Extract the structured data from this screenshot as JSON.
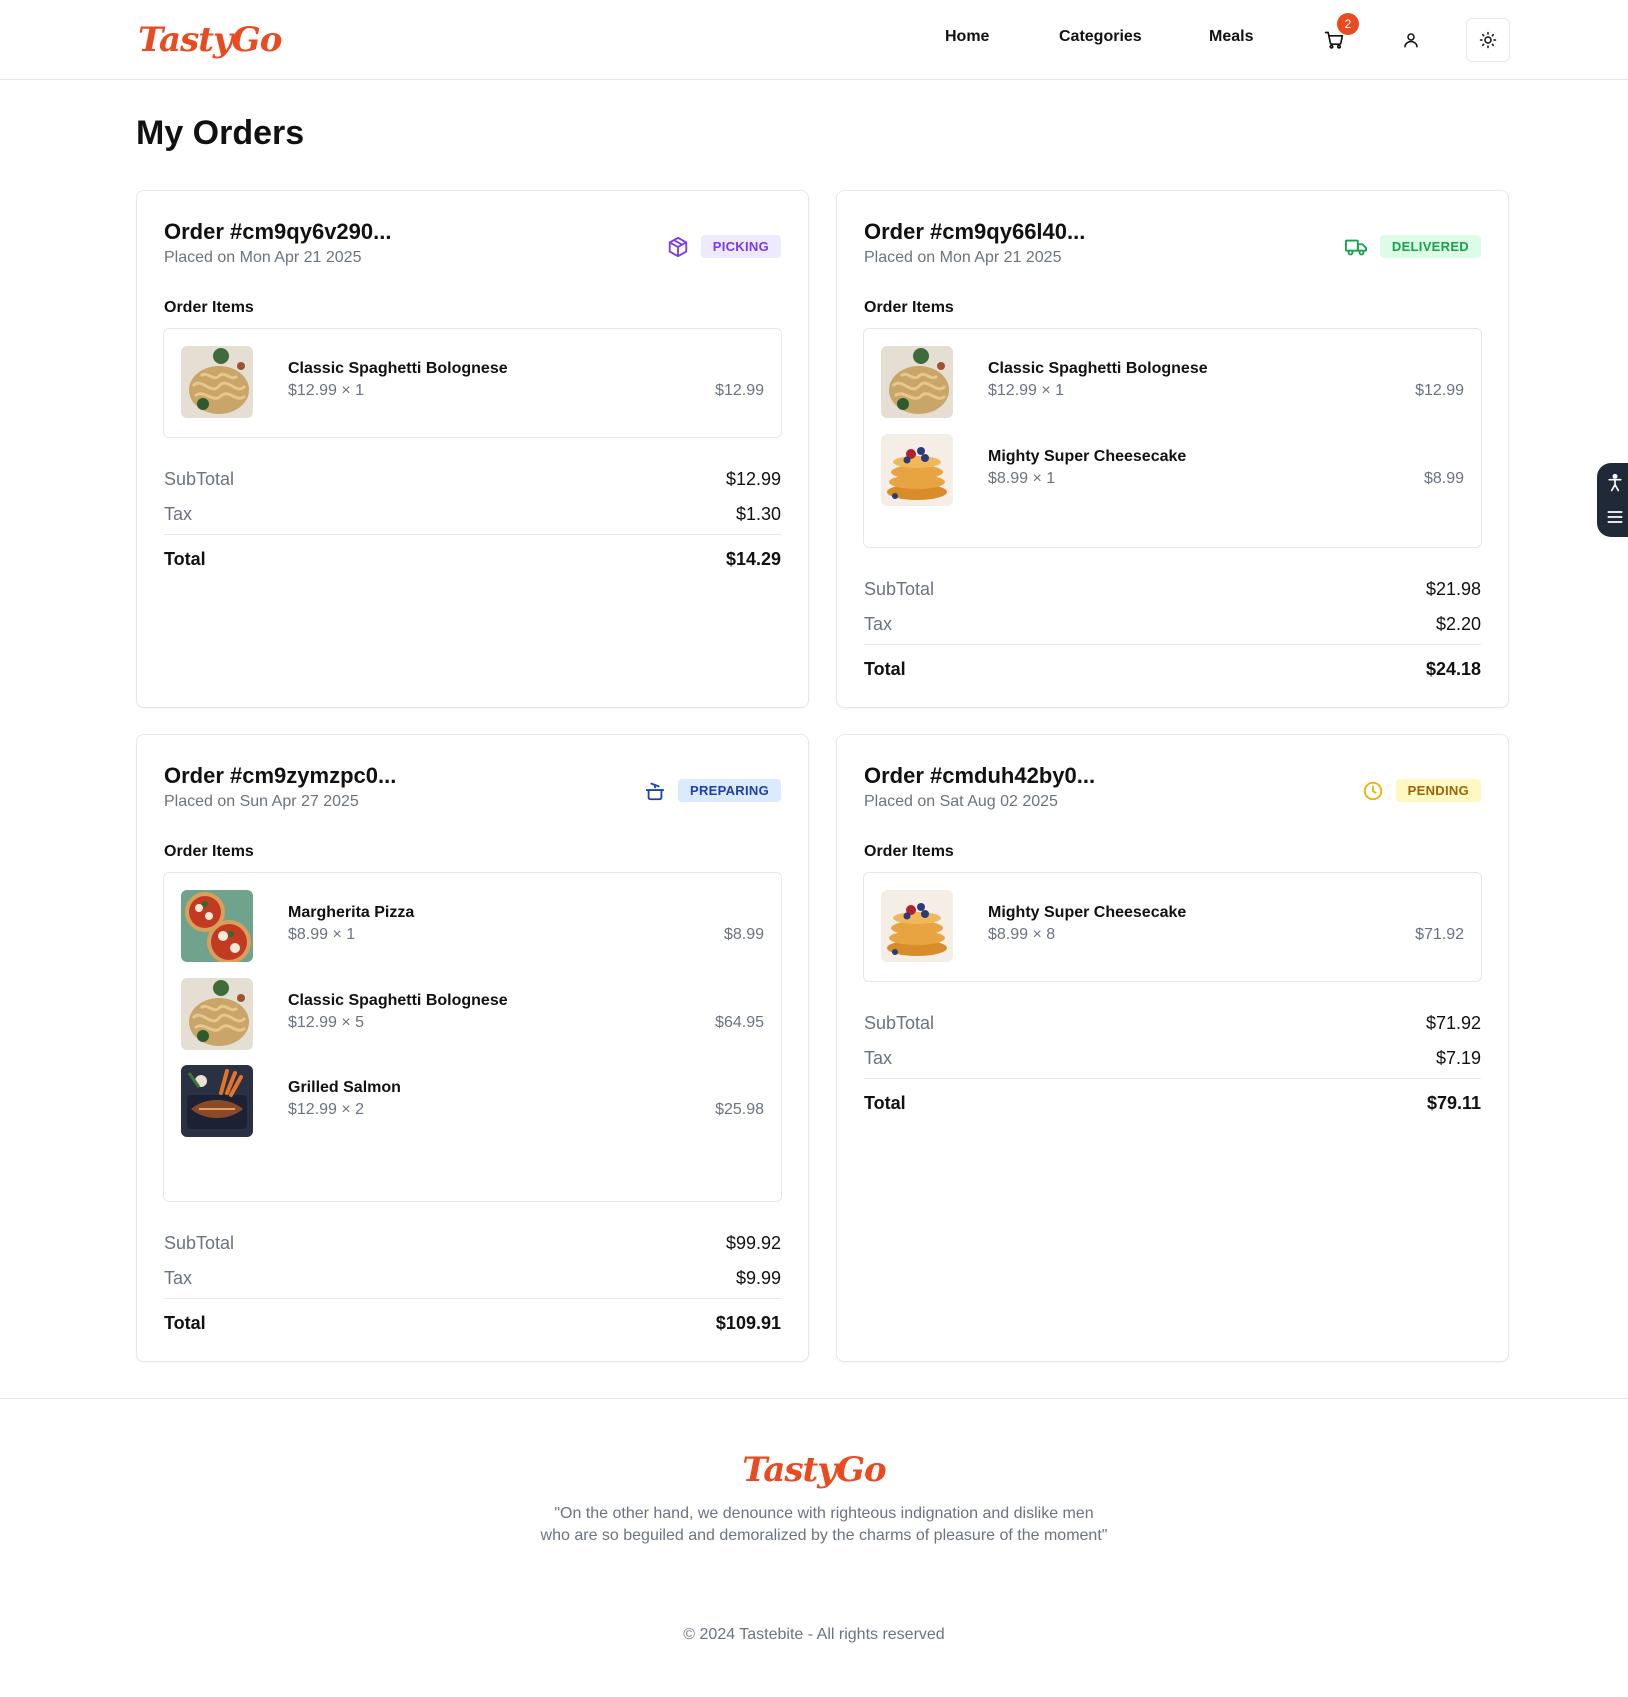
{
  "header": {
    "logo": "TastyGo",
    "nav": [
      "Home",
      "Categories",
      "Meals"
    ],
    "cart_count": "2"
  },
  "page": {
    "title": "My Orders"
  },
  "labels": {
    "order_items": "Order Items",
    "subtotal": "SubTotal",
    "tax": "Tax",
    "total": "Total"
  },
  "orders": [
    {
      "id": "Order #cm9qy6v290...",
      "date": "Placed on Mon Apr 21 2025",
      "status": "PICKING",
      "status_icon": "package-icon",
      "status_color": "#7c3aed",
      "status_bg": "#ede9fe",
      "items": [
        {
          "name": "Classic Spaghetti Bolognese",
          "qty": "$12.99 × 1",
          "total": "$12.99",
          "image": "spaghetti"
        }
      ],
      "subtotal": "$12.99",
      "tax": "$1.30",
      "total": "$14.29"
    },
    {
      "id": "Order #cm9qy66l40...",
      "date": "Placed on Mon Apr 21 2025",
      "status": "DELIVERED",
      "status_icon": "truck-icon",
      "status_color": "#16a34a",
      "status_bg": "#dcfce7",
      "items": [
        {
          "name": "Classic Spaghetti Bolognese",
          "qty": "$12.99 × 1",
          "total": "$12.99",
          "image": "spaghetti"
        },
        {
          "name": "Mighty Super Cheesecake",
          "qty": "$8.99 × 1",
          "total": "$8.99",
          "image": "pancakes"
        }
      ],
      "subtotal": "$21.98",
      "tax": "$2.20",
      "total": "$24.18"
    },
    {
      "id": "Order #cm9zymzpc0...",
      "date": "Placed on Sun Apr 27 2025",
      "status": "PREPARING",
      "status_icon": "cooking-pot-icon",
      "status_color": "#1e40af",
      "status_bg": "#dbeafe",
      "items": [
        {
          "name": "Margherita Pizza",
          "qty": "$8.99 × 1",
          "total": "$8.99",
          "image": "pizza"
        },
        {
          "name": "Classic Spaghetti Bolognese",
          "qty": "$12.99 × 5",
          "total": "$64.95",
          "image": "spaghetti"
        },
        {
          "name": "Grilled Salmon",
          "qty": "$12.99 × 2",
          "total": "$25.98",
          "image": "salmon"
        }
      ],
      "subtotal": "$99.92",
      "tax": "$9.99",
      "total": "$109.91"
    },
    {
      "id": "Order #cmduh42by0...",
      "date": "Placed on Sat Aug 02 2025",
      "status": "PENDING",
      "status_icon": "clock-icon",
      "status_color": "#a16207",
      "status_bg": "#fef9c3",
      "items": [
        {
          "name": "Mighty Super Cheesecake",
          "qty": "$8.99 × 8",
          "total": "$71.92",
          "image": "pancakes"
        }
      ],
      "subtotal": "$71.92",
      "tax": "$7.19",
      "total": "$79.11"
    }
  ],
  "footer": {
    "logo": "TastyGo",
    "quote": "\"On the other hand, we denounce with righteous indignation and dislike men who are so beguiled and demoralized by the charms of pleasure of the moment\"",
    "copyright": "© 2024 Tastebite - All rights reserved"
  }
}
